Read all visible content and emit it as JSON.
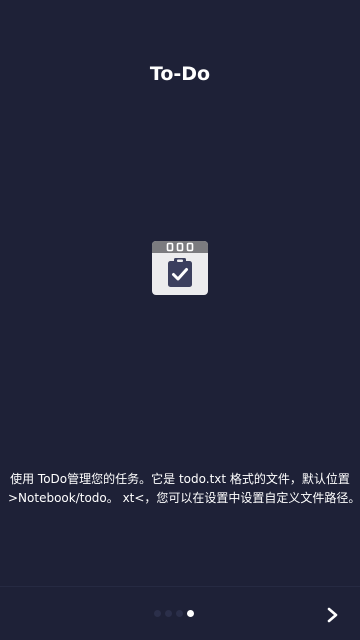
{
  "onboarding": {
    "title": "To-Do",
    "description_line1": "使用 ToDo管理您的任务。它是 todo.txt 格式的文件，默认位置",
    "description_line2": ">Notebook/todo。 xt<，您可以在设置中设置自定义文件路径。",
    "app_icon": "clipboard-check-icon",
    "pager": {
      "total": 4,
      "active_index": 3
    },
    "next_icon": "chevron-right-icon"
  },
  "colors": {
    "background": "#1e2137",
    "text": "#ffffff",
    "icon_header": "#7b7b7f",
    "icon_body": "#ececee",
    "icon_clipboard": "#3b3f5e",
    "dot_inactive": "#2b2f4a",
    "dot_active": "#ffffff"
  }
}
